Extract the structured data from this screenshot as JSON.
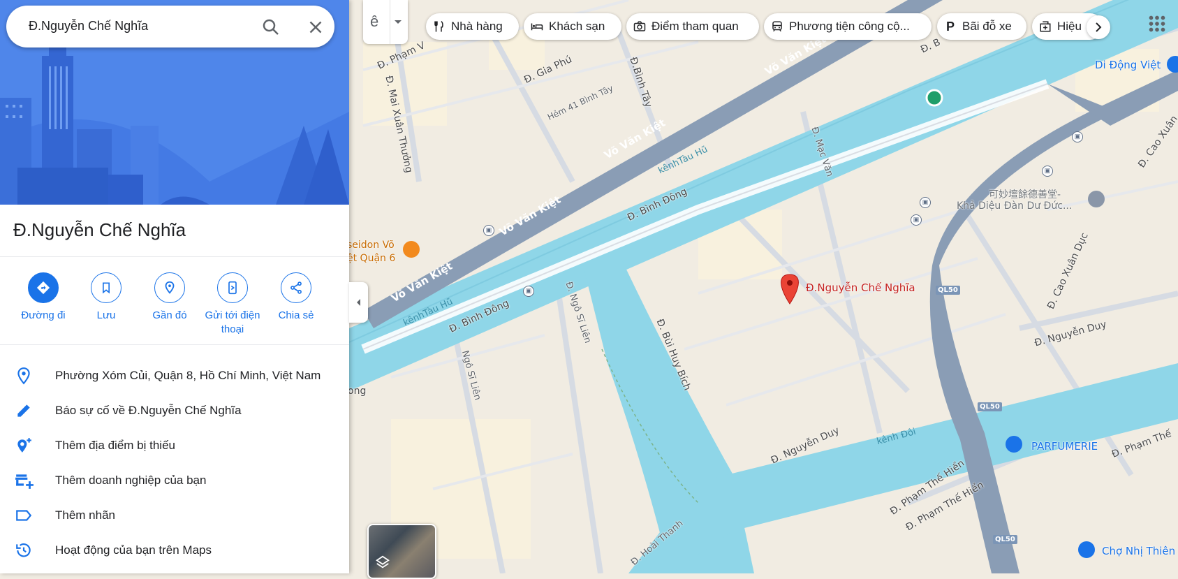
{
  "search": {
    "value": "Đ.Nguyễn Chế Nghĩa"
  },
  "place": {
    "title": "Đ.Nguyễn Chế Nghĩa"
  },
  "actions": [
    {
      "label": "Đường đi",
      "icon": "directions-icon"
    },
    {
      "label": "Lưu",
      "icon": "bookmark-icon"
    },
    {
      "label": "Gần đó",
      "icon": "nearby-icon"
    },
    {
      "label": "Gửi tới điện thoại",
      "icon": "send-to-phone-icon"
    },
    {
      "label": "Chia sẻ",
      "icon": "share-icon"
    }
  ],
  "details": [
    {
      "text": "Phường Xóm Củi, Quận 8, Hồ Chí Minh, Việt Nam",
      "icon": "location-pin-icon"
    },
    {
      "text": "Báo sự cố về Đ.Nguyễn Chế Nghĩa",
      "icon": "pencil-icon"
    },
    {
      "text": "Thêm địa điểm bị thiếu",
      "icon": "add-place-icon"
    },
    {
      "text": "Thêm doanh nghiệp của bạn",
      "icon": "add-business-icon"
    },
    {
      "text": "Thêm nhãn",
      "icon": "label-icon"
    },
    {
      "text": "Hoạt động của bạn trên Maps",
      "icon": "history-icon"
    }
  ],
  "layer_button": {
    "glyph": "ê"
  },
  "chips": [
    {
      "label": "Nhà hàng",
      "icon": "restaurant-icon"
    },
    {
      "label": "Khách sạn",
      "icon": "hotel-icon"
    },
    {
      "label": "Điểm tham quan",
      "icon": "camera-icon"
    },
    {
      "label": "Phương tiện công cộ...",
      "icon": "transit-icon"
    },
    {
      "label": "Bãi đỗ xe",
      "icon": "parking-icon"
    },
    {
      "label": "Hiệu",
      "icon": "pharmacy-icon"
    }
  ],
  "map": {
    "pin_label": "Đ.Nguyễn Chế Nghĩa",
    "streets": {
      "vo_van_kiet": "Võ Văn Kiệt",
      "binh_dong": "Đ. Bình Đông",
      "pham_van": "Đ. Phạm V",
      "gia_phu": "Đ. Gia Phú",
      "binh_tay": "Đ.Bình Tây",
      "hem41": "Hẻm 41 Bình Tây",
      "mai_xuan_thuong": "Đ. Mai Xuân Thưởng",
      "mac_van": "Đ. Mạc Văn",
      "ngo_si_lien": "Đ. Ngô Sĩ Liên",
      "ngo_si_lien2": "Ngô Sĩ Liên",
      "bui_huy_bich": "Đ. Bùi Huy Bích",
      "nguyen_duy": "Đ. Nguyễn Duy",
      "pham_the_hien": "Đ. Phạm Thế Hiển",
      "pham_the_hien_short": "Đ. Phạm Thế",
      "hoai_thanh": "Đ. Hoài Thanh",
      "cao_xuan_duc": "Đ. Cao Xuân Dục",
      "cao_xuan": "Đ. Cao Xuân",
      "ong": "ong",
      "kenh_tau_hu": "kênhTàu Hũ",
      "kenh_doi": "kênh Đôi",
      "ql50": "QL50",
      "b_top": "Đ. B"
    },
    "pois": {
      "di_dong_viet": "Di Động Việt",
      "poseidon_1": "seidon Võ",
      "poseidon_2": "ệt Quận 6",
      "temple_cn": "可妙壇餘德善堂-",
      "temple_vn": "Khả Diệu Đàn Dư Đức...",
      "parfumerie": "PARFUMERIE",
      "cho_nhi_thien": "Chợ Nhị Thiên"
    }
  }
}
